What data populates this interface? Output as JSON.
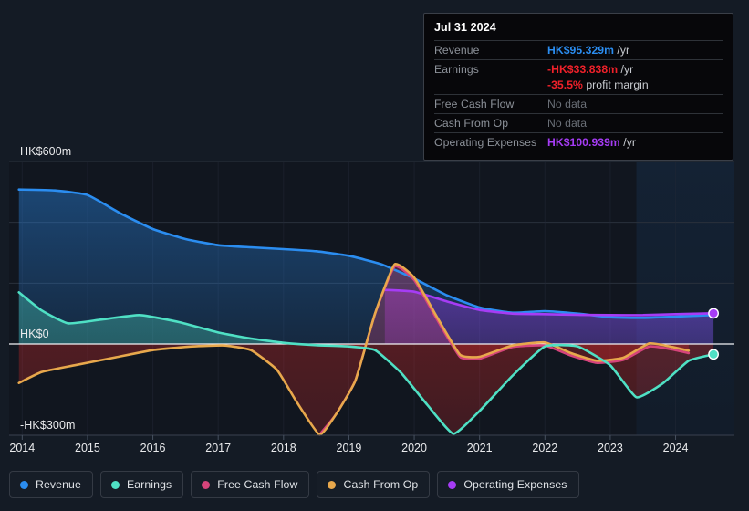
{
  "tooltip": {
    "date": "Jul 31 2024",
    "rows": [
      {
        "label": "Revenue",
        "value": "HK$95.329m",
        "unit": " /yr",
        "style": "revenue"
      },
      {
        "label": "Earnings",
        "value": "-HK$33.838m",
        "unit": " /yr",
        "style": "earnings"
      },
      {
        "label": "",
        "value": "-35.5%",
        "unit": " profit margin",
        "style": "margin"
      },
      {
        "label": "Free Cash Flow",
        "value": "No data",
        "unit": "",
        "style": "nodata"
      },
      {
        "label": "Cash From Op",
        "value": "No data",
        "unit": "",
        "style": "nodata"
      },
      {
        "label": "Operating Expenses",
        "value": "HK$100.939m",
        "unit": " /yr",
        "style": "opex"
      }
    ]
  },
  "legend": {
    "items": [
      {
        "label": "Revenue",
        "color": "#2b8df0"
      },
      {
        "label": "Earnings",
        "color": "#4fe0c4"
      },
      {
        "label": "Free Cash Flow",
        "color": "#d6447b"
      },
      {
        "label": "Cash From Op",
        "color": "#e8a84c"
      },
      {
        "label": "Operating Expenses",
        "color": "#a63cf5"
      }
    ]
  },
  "chart_data": {
    "type": "area",
    "title": "",
    "xlabel": "",
    "ylabel": "",
    "currency": "HK$",
    "unit": "m",
    "grid": true,
    "legend_position": "bottom",
    "ylim": [
      -300,
      600
    ],
    "y_ticks": [
      600,
      0,
      -300
    ],
    "y_tick_labels": [
      "HK$600m",
      "HK$0",
      "-HK$300m"
    ],
    "y_gridlines": [
      600,
      400,
      200,
      0,
      -300
    ],
    "xlim": [
      2013.8,
      2024.9
    ],
    "x_ticks": [
      2014,
      2015,
      2016,
      2017,
      2018,
      2019,
      2020,
      2021,
      2022,
      2023,
      2024
    ],
    "x_tick_labels": [
      "2014",
      "2015",
      "2016",
      "2017",
      "2018",
      "2019",
      "2020",
      "2021",
      "2022",
      "2023",
      "2024"
    ],
    "forecast_start": 2023.4,
    "series": [
      {
        "name": "Revenue",
        "color": "#2b8df0",
        "x": [
          2013.95,
          2014.5,
          2015.0,
          2015.5,
          2016.0,
          2016.5,
          2017.0,
          2017.5,
          2018.0,
          2018.5,
          2019.0,
          2019.5,
          2020.0,
          2020.5,
          2021.0,
          2021.5,
          2022.0,
          2022.5,
          2023.0,
          2023.5,
          2024.0,
          2024.58
        ],
        "values": [
          508,
          505,
          490,
          430,
          378,
          345,
          325,
          318,
          312,
          305,
          290,
          262,
          215,
          160,
          120,
          103,
          108,
          100,
          88,
          86,
          90,
          95.329
        ]
      },
      {
        "name": "Earnings",
        "color": "#4fe0c4",
        "x": [
          2013.95,
          2014.3,
          2014.7,
          2015.2,
          2015.8,
          2016.4,
          2017.0,
          2017.5,
          2018.0,
          2018.5,
          2019.0,
          2019.4,
          2019.8,
          2020.2,
          2020.6,
          2021.0,
          2021.5,
          2022.0,
          2022.5,
          2023.0,
          2023.4,
          2023.8,
          2024.2,
          2024.58
        ],
        "values": [
          170,
          110,
          68,
          80,
          95,
          72,
          38,
          18,
          4,
          -4,
          -8,
          -20,
          -95,
          -200,
          -295,
          -220,
          -105,
          -8,
          -8,
          -70,
          -175,
          -130,
          -55,
          -33.838
        ]
      },
      {
        "name": "Free Cash Flow",
        "color": "#d6447b",
        "x": [
          2018.55,
          2018.8,
          2019.1,
          2019.4,
          2019.7,
          2020.0,
          2020.35,
          2020.7,
          2021.0,
          2021.5,
          2022.0,
          2022.4,
          2022.8,
          2023.2,
          2023.6,
          2023.95,
          2024.2
        ],
        "values": [
          -298,
          -232,
          -120,
          100,
          255,
          210,
          80,
          -42,
          -48,
          -10,
          -5,
          -38,
          -62,
          -52,
          -8,
          -18,
          -30
        ]
      },
      {
        "name": "Cash From Op",
        "color": "#e8a84c",
        "x": [
          2013.95,
          2014.3,
          2014.8,
          2015.4,
          2016.0,
          2016.6,
          2017.1,
          2017.5,
          2017.9,
          2018.2,
          2018.55,
          2018.8,
          2019.1,
          2019.4,
          2019.7,
          2020.0,
          2020.35,
          2020.7,
          2021.0,
          2021.5,
          2022.0,
          2022.4,
          2022.8,
          2023.2,
          2023.6,
          2023.95,
          2024.2
        ],
        "values": [
          -128,
          -92,
          -70,
          -45,
          -20,
          -8,
          -5,
          -20,
          -85,
          -190,
          -298,
          -232,
          -120,
          100,
          262,
          218,
          88,
          -35,
          -42,
          -5,
          5,
          -30,
          -55,
          -45,
          2,
          -10,
          -22
        ]
      },
      {
        "name": "Operating Expenses",
        "color": "#a63cf5",
        "x": [
          2019.55,
          2020.0,
          2020.5,
          2021.0,
          2021.5,
          2022.0,
          2022.5,
          2023.0,
          2023.5,
          2024.0,
          2024.58
        ],
        "values": [
          178,
          172,
          140,
          112,
          100,
          98,
          96,
          95,
          95,
          98,
          100.939
        ]
      }
    ]
  }
}
